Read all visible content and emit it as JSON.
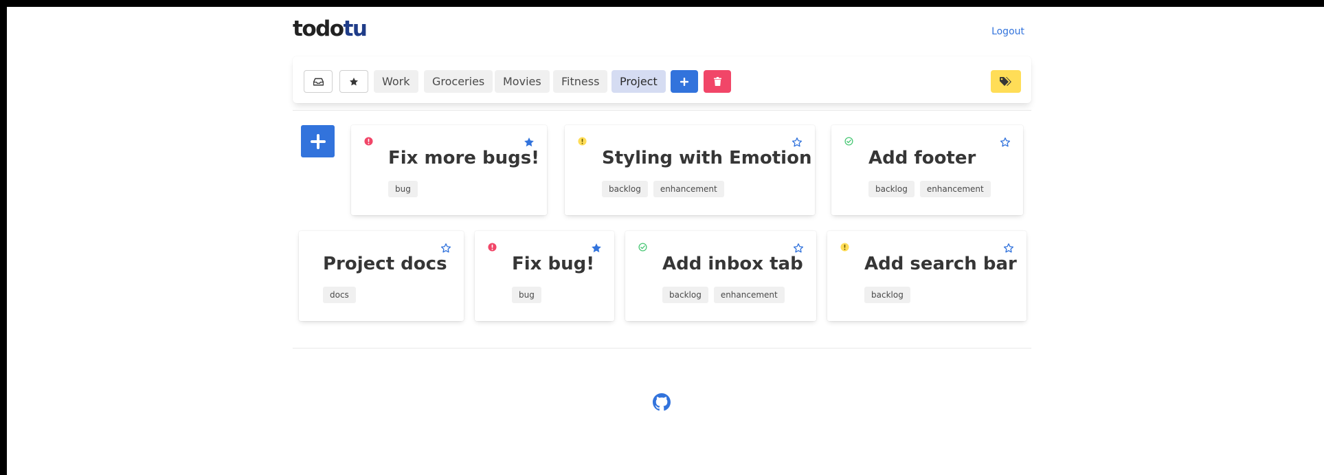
{
  "header": {
    "logo_part1": "todo",
    "logo_part2": "tu",
    "logout_label": "Logout"
  },
  "toolbar": {
    "inbox_icon": "inbox-icon",
    "starred_icon": "star-icon",
    "filters": [
      {
        "label": "Work",
        "active": false
      },
      {
        "label": "Groceries",
        "active": false
      },
      {
        "label": "Movies",
        "active": false
      },
      {
        "label": "Fitness",
        "active": false
      },
      {
        "label": "Project",
        "active": true
      }
    ],
    "add_icon": "plus-icon",
    "delete_icon": "trash-icon",
    "tags_icon": "tags-icon"
  },
  "add_todo_icon": "plus-icon",
  "todos": [
    {
      "title": "Fix more bugs!",
      "status": "urgent",
      "starred": true,
      "tags": [
        "bug"
      ]
    },
    {
      "title": "Styling with Emotion",
      "status": "warning",
      "starred": false,
      "tags": [
        "backlog",
        "enhancement"
      ]
    },
    {
      "title": "Add footer",
      "status": "done",
      "starred": false,
      "tags": [
        "backlog",
        "enhancement"
      ]
    },
    {
      "title": "Project docs",
      "status": "none",
      "starred": false,
      "tags": [
        "docs"
      ]
    },
    {
      "title": "Fix bug!",
      "status": "urgent",
      "starred": true,
      "tags": [
        "bug"
      ]
    },
    {
      "title": "Add inbox tab",
      "status": "done",
      "starred": false,
      "tags": [
        "backlog",
        "enhancement"
      ]
    },
    {
      "title": "Add search bar",
      "status": "warning",
      "starred": false,
      "tags": [
        "backlog"
      ]
    }
  ],
  "colors": {
    "primary": "#3273dc",
    "danger": "#f14668",
    "warning": "#ffdd57",
    "success": "#48c774",
    "active_filter": "#d5dcf2",
    "logo_accent": "#1f3c88"
  },
  "footer": {
    "github_icon": "github-icon"
  }
}
